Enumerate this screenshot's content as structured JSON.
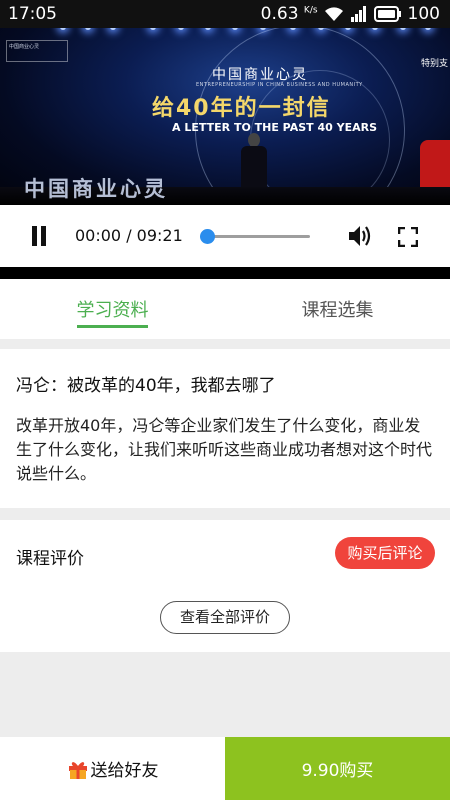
{
  "status_bar": {
    "time": "17:05",
    "net_speed": "0.63",
    "net_speed_unit": "K/s",
    "network": "3G",
    "battery": "100"
  },
  "video": {
    "logo_text": "中国商业心灵",
    "logo_sub": "ENTREPRENEURSHIP IN CHINA  BUSINESS AND HUMANITY",
    "title_cn": "给40年的一封信",
    "title_en": "A LETTER TO THE PAST 40 YEARS",
    "brand_text": "中国商业心灵",
    "right_text": "特别支",
    "corner_text": "中国商业心灵"
  },
  "player": {
    "current_time": "00:00",
    "duration": "09:21",
    "time_display": "00:00 / 09:21",
    "progress": 0.0
  },
  "tabs": [
    {
      "label": "学习资料",
      "active": true
    },
    {
      "label": "课程选集",
      "active": false
    }
  ],
  "description": {
    "title": "冯仑：被改革的40年，我都去哪了",
    "body": "改革开放40年，冯仑等企业家们发生了什么变化，商业发生了什么变化，让我们来听听这些商业成功者想对这个时代说些什么。"
  },
  "reviews": {
    "title": "课程评价",
    "review_after_purchase": "购买后评论",
    "view_all": "查看全部评价"
  },
  "bottom_bar": {
    "gift_label": "送给好友",
    "buy_label": "9.90购买"
  },
  "colors": {
    "accent_green": "#4caf50",
    "buy_green": "#8dc21f",
    "review_red": "#f0443c",
    "seek_blue": "#2b8ded"
  }
}
